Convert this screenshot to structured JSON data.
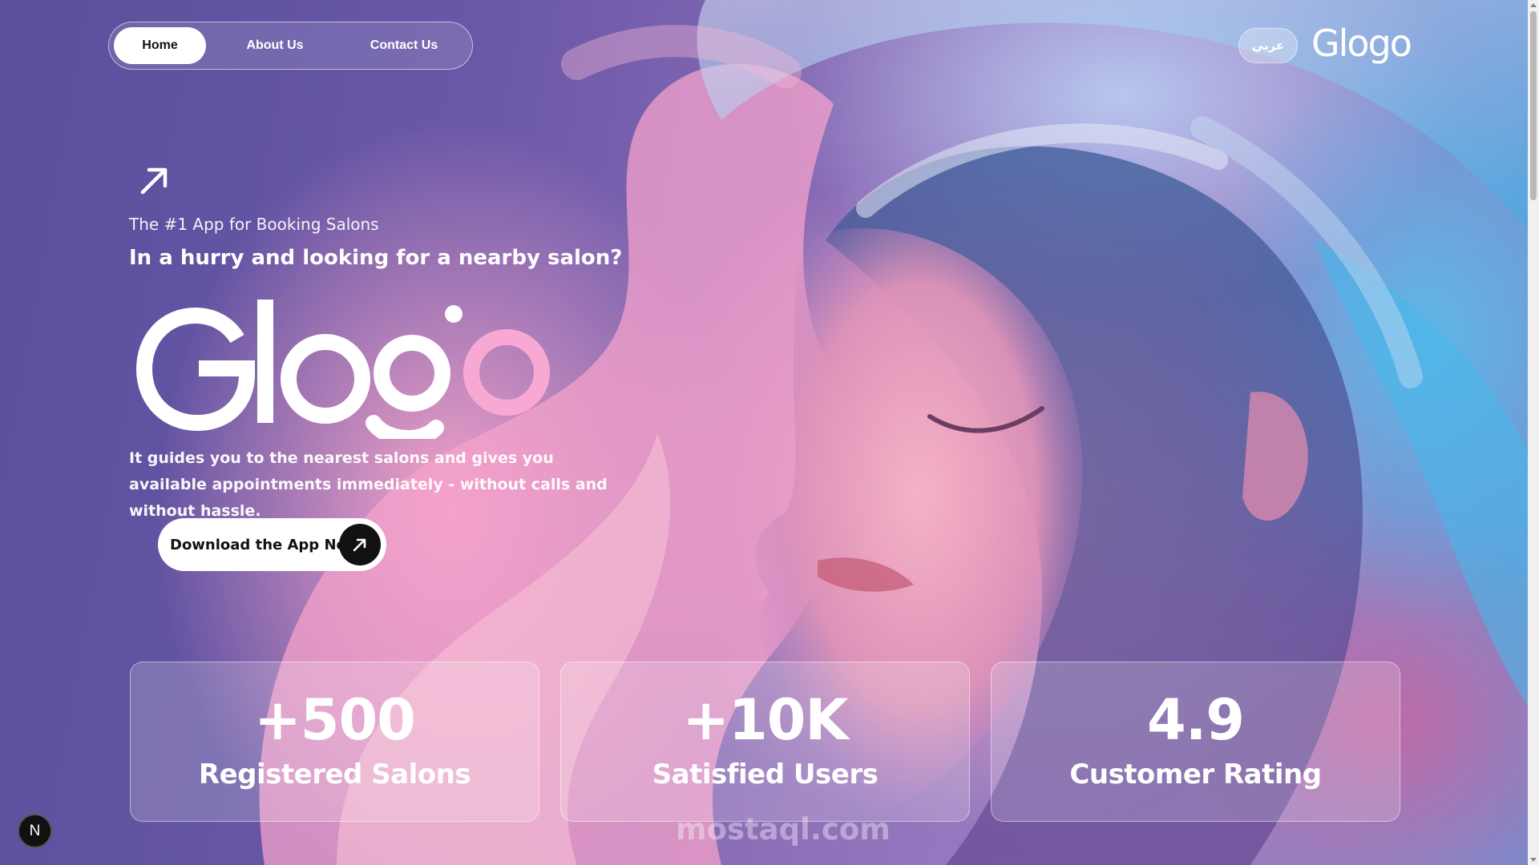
{
  "nav": {
    "items": [
      {
        "label": "Home",
        "active": true
      },
      {
        "label": "About Us",
        "active": false
      },
      {
        "label": "Contact Us",
        "active": false
      }
    ],
    "language_toggle": "عربي"
  },
  "brand": {
    "logo_text": "Glogo",
    "logo_color": "#ffffff",
    "logo_accent_color": "#f7a9d4"
  },
  "hero": {
    "arrow_icon": "arrow-up-right-icon",
    "tagline": "The #1 App for Booking Salons",
    "headline": "In a hurry and looking for a nearby salon?",
    "description": "It guides you to the nearest salons and gives you available appointments immediately - without calls and without hassle.",
    "cta_label": "Download the App Now"
  },
  "stats": [
    {
      "value": "+500",
      "label": "Registered Salons"
    },
    {
      "value": "+10K",
      "label": "Satisfied Users"
    },
    {
      "value": "4.9",
      "label": "Customer Rating"
    }
  ],
  "watermark": "mostaql.com",
  "dev_badge": "N",
  "colors": {
    "background_purple": "#6a58a8",
    "card_border": "#ffffff",
    "cta_background": "#ffffff",
    "cta_icon_background": "#111111"
  }
}
